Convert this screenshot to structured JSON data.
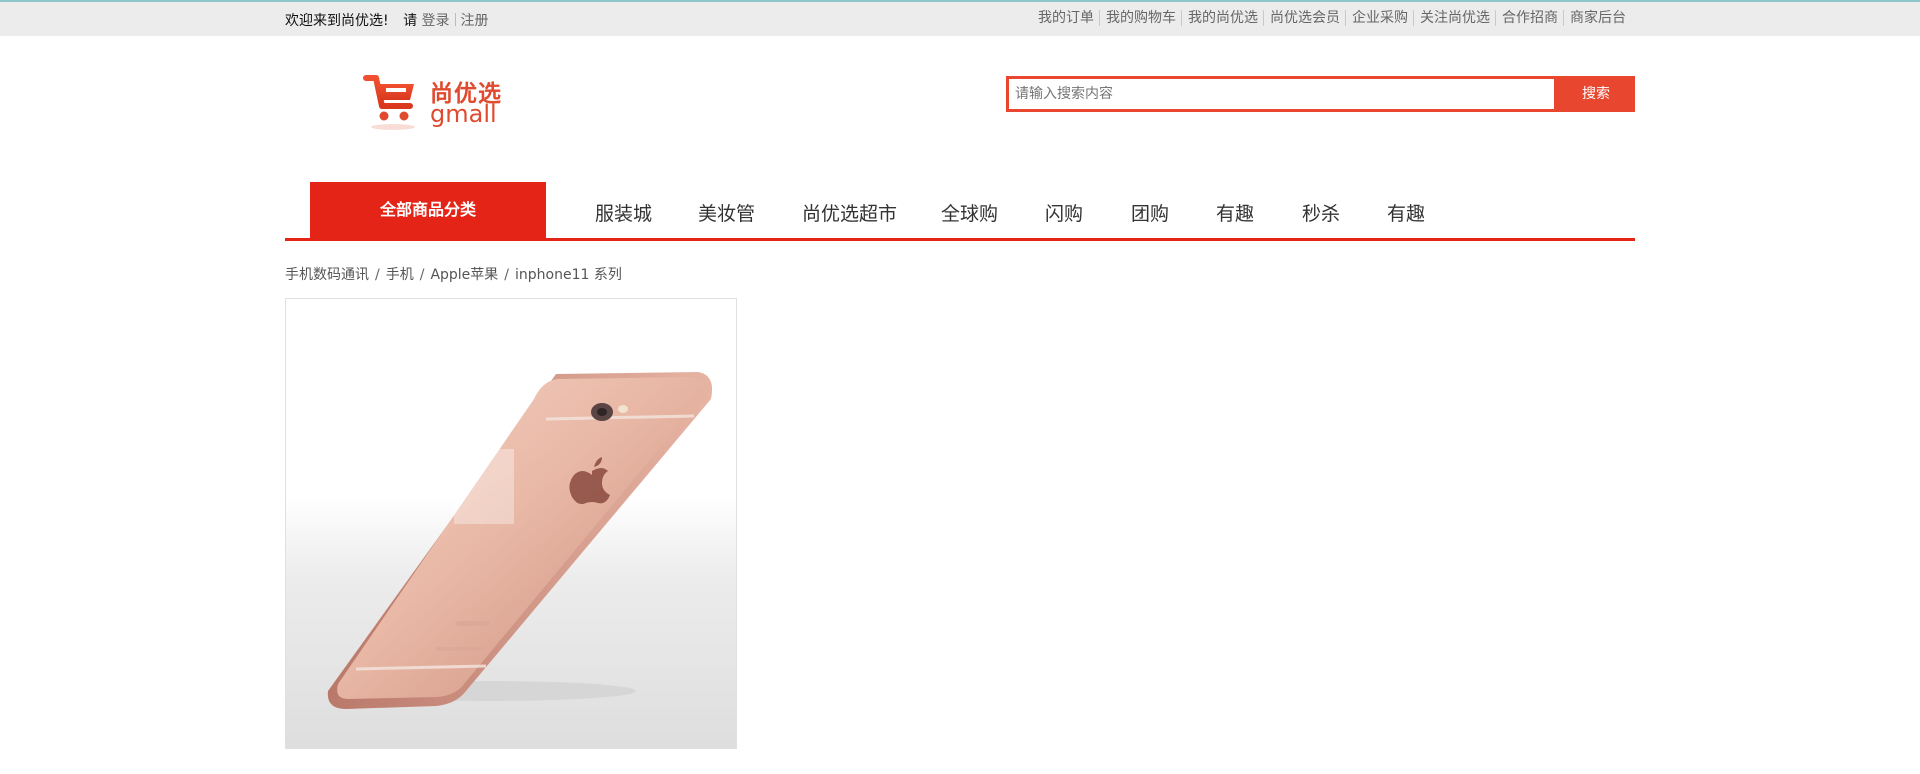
{
  "topbar": {
    "welcome": "欢迎来到尚优选!",
    "please": "请",
    "login": "登录",
    "register": "注册",
    "links": [
      "我的订单",
      "我的购物车",
      "我的尚优选",
      "尚优选会员",
      "企业采购",
      "关注尚优选",
      "合作招商",
      "商家后台"
    ]
  },
  "logo": {
    "cn": "尚优选",
    "en": "gmall"
  },
  "search": {
    "placeholder": "请输入搜索内容",
    "button": "搜索"
  },
  "nav": {
    "all_categories": "全部商品分类",
    "items": [
      "服装城",
      "美妆管",
      "尚优选超市",
      "全球购",
      "闪购",
      "团购",
      "有趣",
      "秒杀",
      "有趣"
    ]
  },
  "breadcrumb": [
    "手机数码通讯",
    "手机",
    "Apple苹果",
    "inphone11 系列"
  ],
  "colors": {
    "accent": "#e32416",
    "search_accent": "#e8462e",
    "logo": "#e04a2f"
  },
  "product": {
    "image": "rose-gold-phone-back"
  }
}
